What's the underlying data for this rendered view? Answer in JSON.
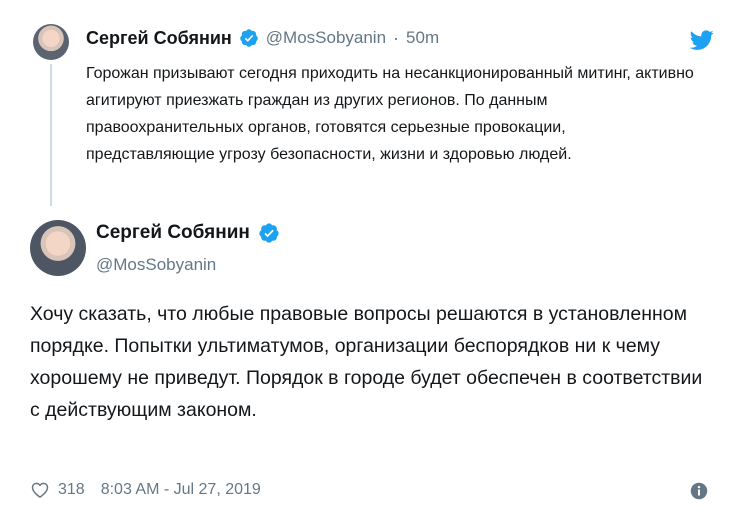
{
  "parent_tweet": {
    "name": "Сергей Собянин",
    "handle": "@MosSobyanin",
    "separator": "·",
    "time": "50m",
    "text": "Горожан призывают сегодня приходить на несанкционированный митинг, активно агитируют приезжать граждан из других регионов. По данным правоохранительных органов, готовятся серьезные провокации, представляющие угрозу безопасности, жизни и здоровью людей."
  },
  "main_tweet": {
    "name": "Сергей Собянин",
    "handle": "@MosSobyanin",
    "text": "Хочу сказать, что любые правовые вопросы решаются в установленном порядке. Попытки ультиматумов, организации беспорядков ни к чему хорошему не приведут. Порядок в городе будет обеспечен в соответствии с действующим законом.",
    "likes": "318",
    "timestamp": "8:03 AM - Jul 27, 2019"
  },
  "icons": {
    "verified": "verified-badge-icon",
    "bird": "twitter-bird-icon",
    "heart": "heart-icon",
    "info": "info-icon"
  },
  "colors": {
    "verified_blue": "#1da1f2",
    "text": "#14171a",
    "muted": "#657786",
    "thread_line": "#cfd9de"
  }
}
